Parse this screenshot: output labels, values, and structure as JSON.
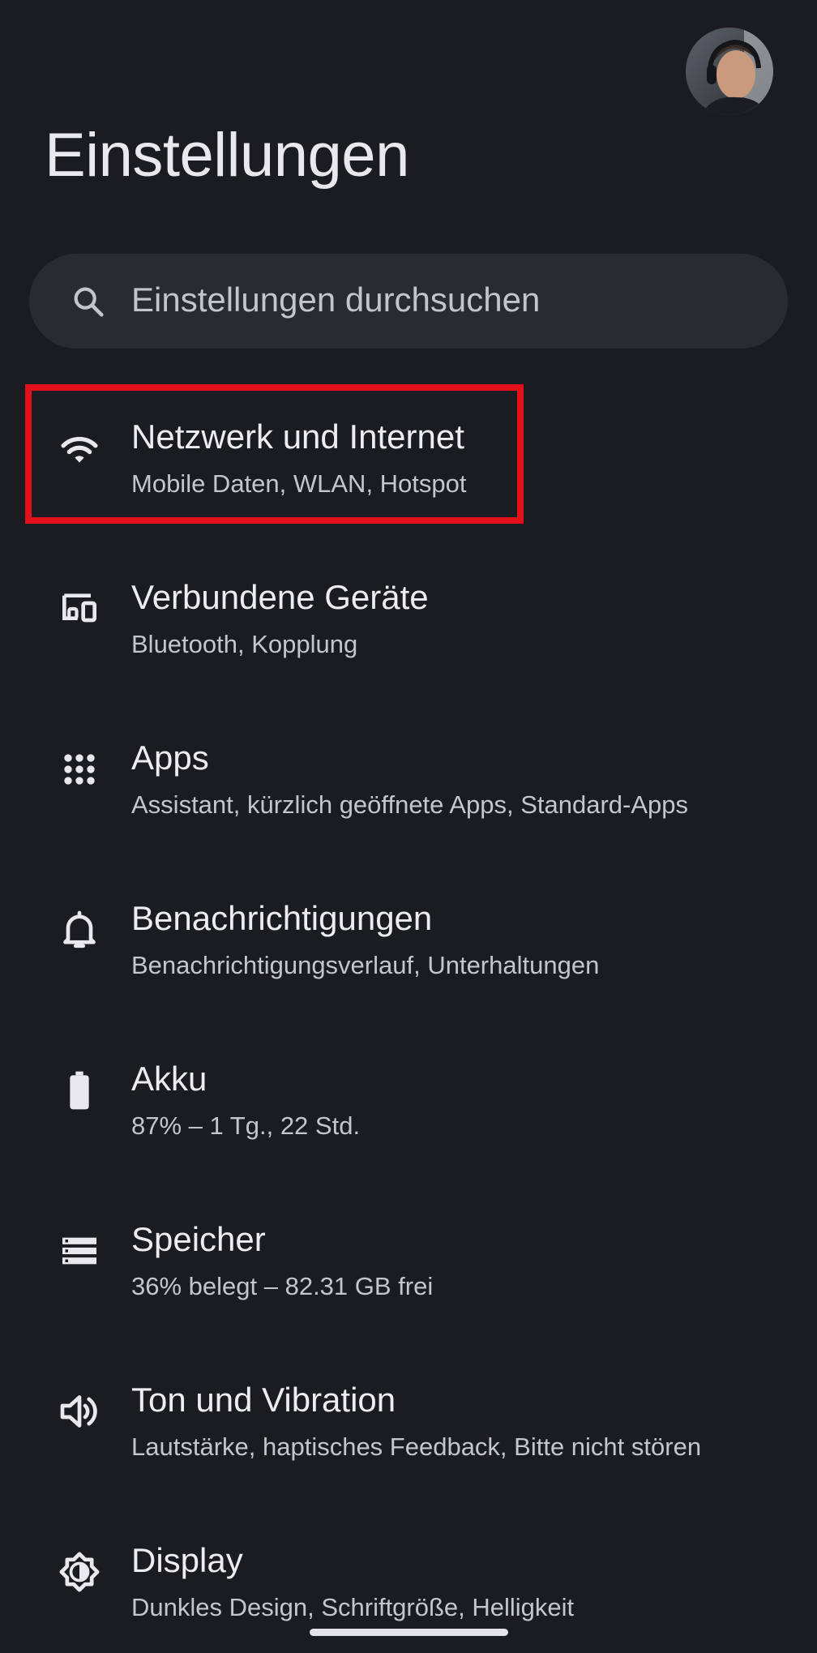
{
  "header": {
    "title": "Einstellungen",
    "avatar_icon": "user-avatar-photo"
  },
  "search": {
    "placeholder": "Einstellungen durchsuchen",
    "icon": "search-icon"
  },
  "settings": [
    {
      "title": "Netzwerk und Internet",
      "subtitle": "Mobile Daten, WLAN, Hotspot",
      "icon": "wifi-icon",
      "highlighted": true
    },
    {
      "title": "Verbundene Geräte",
      "subtitle": "Bluetooth, Kopplung",
      "icon": "connected-devices-icon"
    },
    {
      "title": "Apps",
      "subtitle": "Assistant, kürzlich geöffnete Apps, Standard-Apps",
      "icon": "apps-grid-icon"
    },
    {
      "title": "Benachrichtigungen",
      "subtitle": "Benachrichtigungsverlauf, Unterhaltungen",
      "icon": "bell-icon"
    },
    {
      "title": "Akku",
      "subtitle": "87% – 1 Tg., 22 Std.",
      "icon": "battery-icon"
    },
    {
      "title": "Speicher",
      "subtitle": "36% belegt – 82.31 GB frei",
      "icon": "storage-icon"
    },
    {
      "title": "Ton und Vibration",
      "subtitle": "Lautstärke, haptisches Feedback, Bitte nicht stören",
      "icon": "volume-icon"
    },
    {
      "title": "Display",
      "subtitle": "Dunkles Design, Schriftgröße, Helligkeit",
      "icon": "brightness-icon"
    }
  ],
  "colors": {
    "background": "#1b1c21",
    "search_background": "#2a2b30",
    "highlight": "#e3101a",
    "text_primary": "#ececf1",
    "text_secondary": "#c4c5cd"
  }
}
